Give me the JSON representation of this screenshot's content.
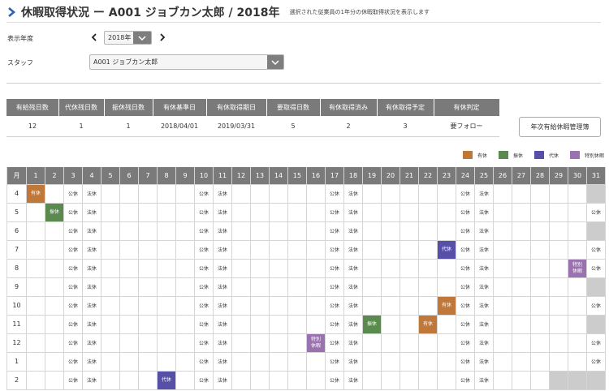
{
  "header": {
    "title": "休暇取得状況 ー A001 ジョブカン太郎 / 2018年",
    "subtitle": "選択された従業員の1年分の休暇取得状況を表示します"
  },
  "filters": {
    "year_label": "表示年度",
    "year_value": "2018年",
    "staff_label": "スタッフ",
    "staff_value": "A001 ジョブカン太郎"
  },
  "summary": {
    "headers": [
      "有給残日数",
      "代休残日数",
      "振休残日数",
      "有休基準日",
      "有休取得期日",
      "要取得日数",
      "有休取得済み",
      "有休取得予定",
      "有休判定"
    ],
    "values": [
      "12",
      "1",
      "1",
      "2018/04/01",
      "2019/03/31",
      "5",
      "2",
      "3",
      "要フォロー"
    ]
  },
  "management_button": "年次有給休暇管理簿",
  "legend": [
    {
      "label": "有休",
      "color": "#c0783a"
    },
    {
      "label": "振休",
      "color": "#5b8a4e"
    },
    {
      "label": "代休",
      "color": "#5650a9"
    },
    {
      "label": "特別休暇",
      "color": "#9a72b0"
    }
  ],
  "calendar": {
    "month_header": "月",
    "days": [
      "1",
      "2",
      "3",
      "4",
      "5",
      "6",
      "7",
      "8",
      "9",
      "10",
      "11",
      "12",
      "13",
      "14",
      "15",
      "16",
      "17",
      "18",
      "19",
      "20",
      "21",
      "22",
      "23",
      "24",
      "25",
      "26",
      "27",
      "28",
      "29",
      "30",
      "31"
    ],
    "rows": [
      {
        "month": "4",
        "holidays": [
          3,
          4,
          10,
          11,
          17,
          18,
          24,
          25
        ],
        "paid_leave": [
          1
        ],
        "sub_leave": [],
        "comp_leave": [],
        "special_leave": [],
        "na": [
          31
        ]
      },
      {
        "month": "5",
        "holidays": [
          3,
          4,
          10,
          11,
          17,
          18,
          24,
          25,
          31
        ],
        "paid_leave": [],
        "sub_leave": [
          2
        ],
        "comp_leave": [],
        "special_leave": [],
        "na": []
      },
      {
        "month": "6",
        "holidays": [
          3,
          4,
          10,
          11,
          17,
          18,
          24,
          25
        ],
        "paid_leave": [],
        "sub_leave": [],
        "comp_leave": [],
        "special_leave": [],
        "na": [
          31
        ]
      },
      {
        "month": "7",
        "holidays": [
          3,
          4,
          10,
          11,
          17,
          18,
          24,
          25,
          31
        ],
        "paid_leave": [],
        "sub_leave": [],
        "comp_leave": [
          23
        ],
        "special_leave": [],
        "na": []
      },
      {
        "month": "8",
        "holidays": [
          3,
          4,
          10,
          11,
          17,
          18,
          24,
          25,
          31
        ],
        "paid_leave": [],
        "sub_leave": [],
        "comp_leave": [],
        "special_leave": [
          30
        ],
        "na": []
      },
      {
        "month": "9",
        "holidays": [
          3,
          4,
          10,
          11,
          17,
          18,
          24,
          25
        ],
        "paid_leave": [],
        "sub_leave": [],
        "comp_leave": [],
        "special_leave": [],
        "na": [
          31
        ]
      },
      {
        "month": "10",
        "holidays": [
          3,
          4,
          10,
          11,
          17,
          18,
          24,
          25,
          31
        ],
        "paid_leave": [
          23
        ],
        "sub_leave": [],
        "comp_leave": [],
        "special_leave": [],
        "na": []
      },
      {
        "month": "11",
        "holidays": [
          3,
          4,
          10,
          11,
          17,
          18,
          24,
          25
        ],
        "paid_leave": [
          22
        ],
        "sub_leave": [
          19
        ],
        "comp_leave": [],
        "special_leave": [],
        "na": [
          31
        ]
      },
      {
        "month": "12",
        "holidays": [
          3,
          4,
          10,
          11,
          17,
          18,
          24,
          25,
          31
        ],
        "paid_leave": [],
        "sub_leave": [],
        "comp_leave": [],
        "special_leave": [
          16
        ],
        "na": []
      },
      {
        "month": "1",
        "holidays": [
          3,
          4,
          10,
          11,
          17,
          18,
          24,
          25,
          31
        ],
        "paid_leave": [],
        "sub_leave": [],
        "comp_leave": [],
        "special_leave": [],
        "na": []
      },
      {
        "month": "2",
        "holidays": [
          3,
          4,
          10,
          11,
          17,
          18,
          24,
          25
        ],
        "paid_leave": [],
        "sub_leave": [],
        "comp_leave": [
          8
        ],
        "special_leave": [],
        "na": [
          29,
          30,
          31
        ]
      }
    ],
    "holiday_even_label": "法休",
    "holiday_odd_label": "公休",
    "paid_leave_label": "有休",
    "sub_leave_label": "振休",
    "comp_leave_label": "代休",
    "special_leave_label": "特別\n休暇"
  }
}
